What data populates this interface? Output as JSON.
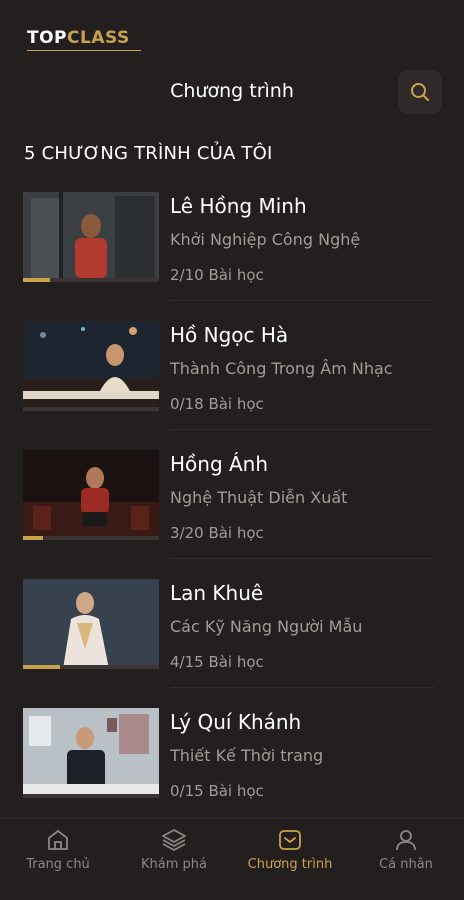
{
  "logo": {
    "part1": "TOP",
    "part2": "CLASS"
  },
  "header": {
    "title": "Chương trình"
  },
  "section": {
    "title": "5 CHƯƠNG TRÌNH CỦA TÔI"
  },
  "colors": {
    "accent": "#c9a24d",
    "background": "#231f1f",
    "muted": "#a39b96"
  },
  "programs": [
    {
      "name": "Lê Hồng Minh",
      "course": "Khởi Nghiệp Công Nghệ",
      "lessons": "2/10 Bài học",
      "progress": 0.2
    },
    {
      "name": "Hồ Ngọc Hà",
      "course": "Thành Công Trong Âm Nhạc",
      "lessons": "0/18 Bài học",
      "progress": 0
    },
    {
      "name": "Hồng Ánh",
      "course": "Nghệ Thuật Diễn Xuất",
      "lessons": "3/20 Bài học",
      "progress": 0.15
    },
    {
      "name": "Lan Khuê",
      "course": "Các Kỹ Năng Người Mẫu",
      "lessons": "4/15 Bài học",
      "progress": 0.27
    },
    {
      "name": "Lý Quí Khánh",
      "course": "Thiết Kế Thời trang",
      "lessons": "0/15 Bài học",
      "progress": 0
    }
  ],
  "tabbar": {
    "tabs": [
      {
        "label": "Trang chủ",
        "icon": "home-icon"
      },
      {
        "label": "Khám phá",
        "icon": "layers-icon"
      },
      {
        "label": "Chương trình",
        "icon": "program-icon",
        "active": true
      },
      {
        "label": "Cá nhân",
        "icon": "user-icon"
      }
    ]
  }
}
